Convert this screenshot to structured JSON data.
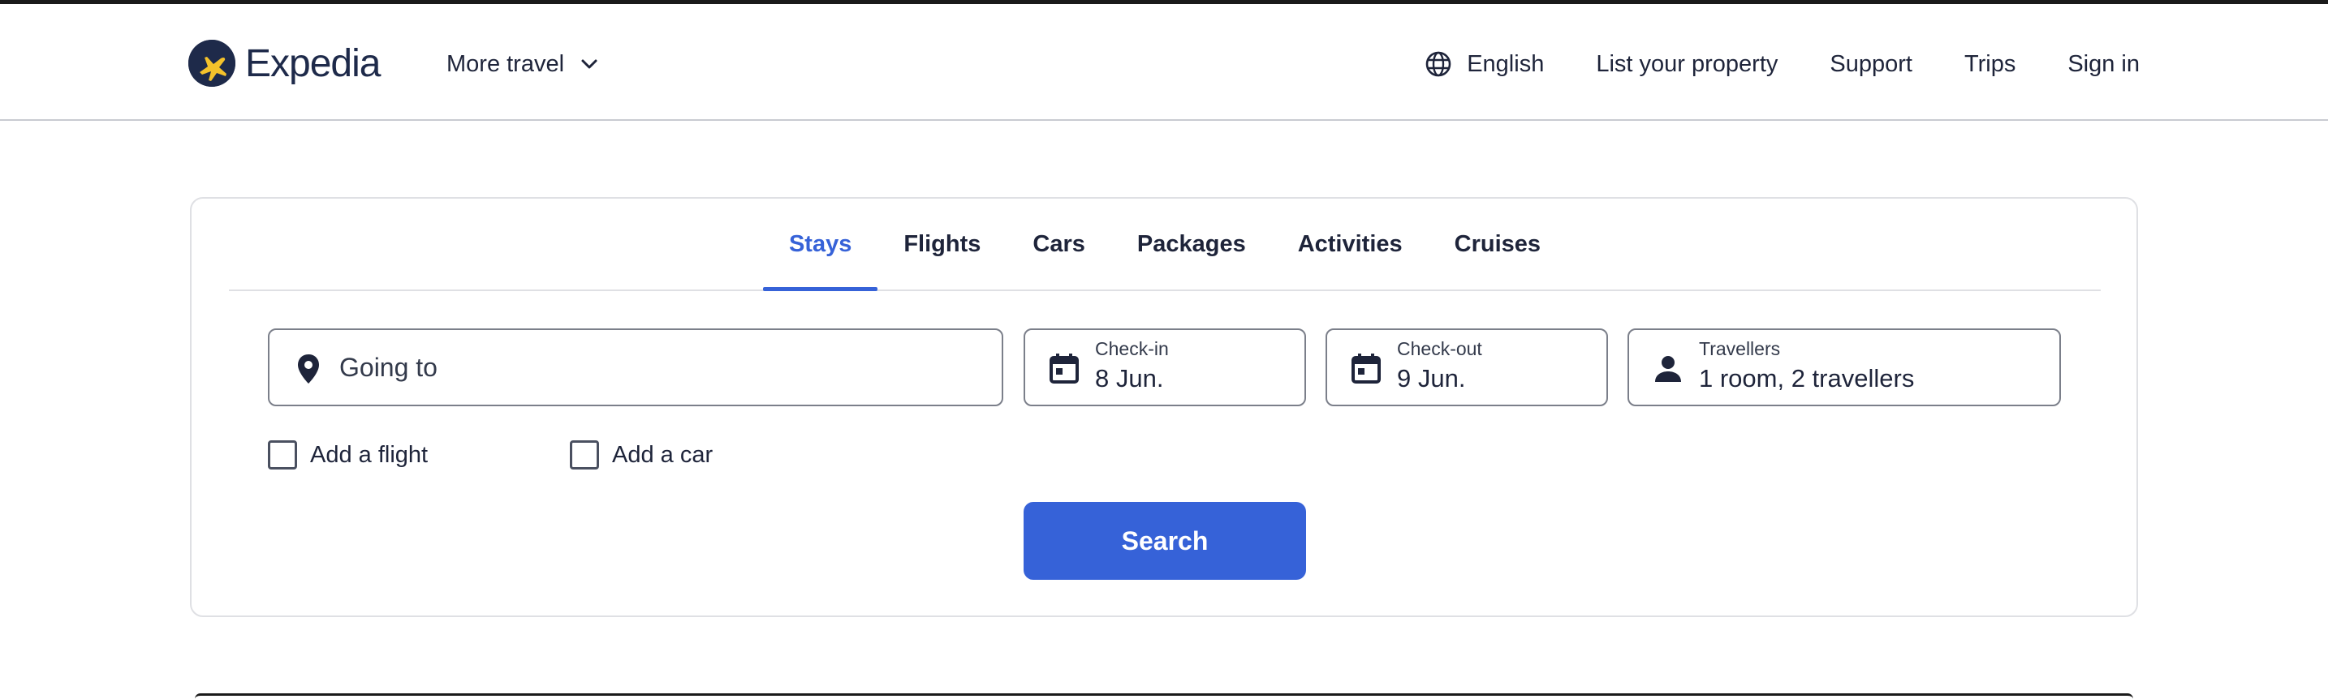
{
  "brand": {
    "name": "Expedia",
    "colors": {
      "primary": "#3662d8",
      "navy": "#1e2a4a",
      "text": "#1e243a",
      "border": "#7b7f8a"
    }
  },
  "header": {
    "more_travel": {
      "label": "More travel",
      "icon": "chevron-down-icon"
    },
    "nav": {
      "language": {
        "label": "English",
        "icon": "globe-icon"
      },
      "list_property": "List your property",
      "support": "Support",
      "trips": "Trips",
      "sign_in": "Sign in"
    }
  },
  "search": {
    "tabs": [
      {
        "label": "Stays",
        "active": true
      },
      {
        "label": "Flights",
        "active": false
      },
      {
        "label": "Cars",
        "active": false
      },
      {
        "label": "Packages",
        "active": false
      },
      {
        "label": "Activities",
        "active": false
      },
      {
        "label": "Cruises",
        "active": false
      }
    ],
    "going_to": {
      "placeholder": "Going to",
      "icon": "location-pin-icon"
    },
    "check_in": {
      "label": "Check-in",
      "value": "8 Jun.",
      "icon": "calendar-icon"
    },
    "check_out": {
      "label": "Check-out",
      "value": "9 Jun.",
      "icon": "calendar-icon"
    },
    "travellers": {
      "label": "Travellers",
      "value": "1 room, 2 travellers",
      "icon": "person-icon"
    },
    "add_flight": {
      "label": "Add a flight",
      "checked": false
    },
    "add_car": {
      "label": "Add a car",
      "checked": false
    },
    "search_button": "Search"
  }
}
